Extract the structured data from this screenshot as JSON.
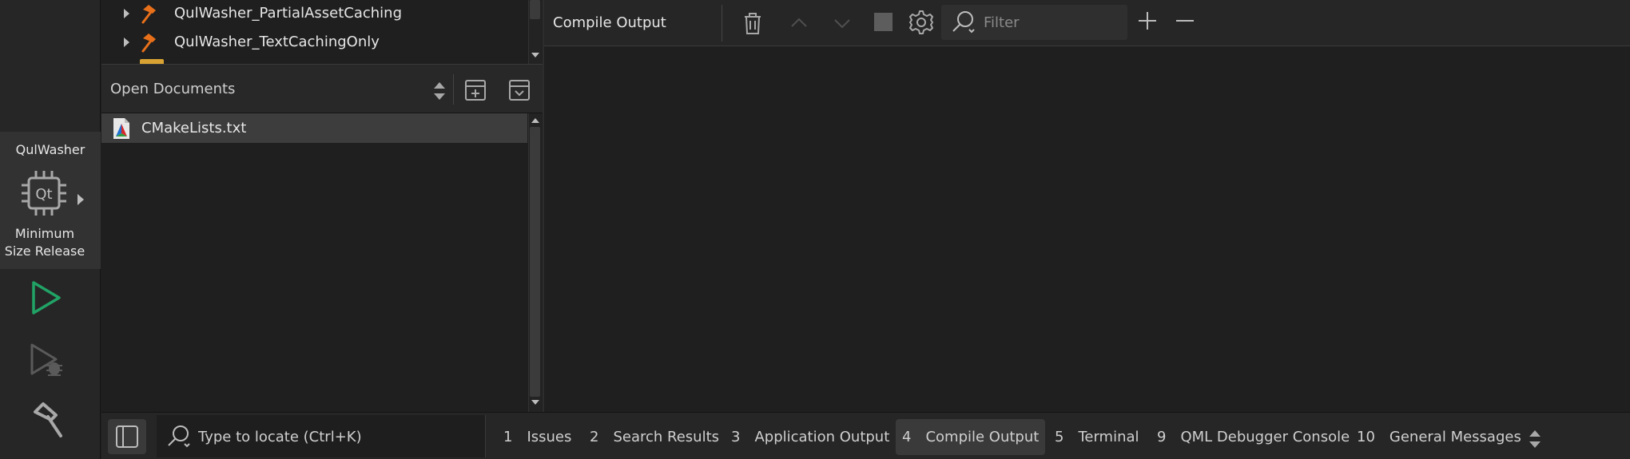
{
  "kit": {
    "project": "QulWasher",
    "build_config": "Minimum Size Release",
    "icon": "qt-chip-icon"
  },
  "modebar": {
    "run_icon": "run-icon",
    "debug_icon": "debug-run-icon",
    "build_icon": "hammer-icon",
    "run_color": "#21a366"
  },
  "project_tree": {
    "items": [
      {
        "label": "QulWasher_PartialAssetCaching",
        "icon": "hammer-icon"
      },
      {
        "label": "QulWasher_TextCachingOnly",
        "icon": "hammer-icon"
      }
    ]
  },
  "open_documents": {
    "title": "Open Documents",
    "documents": [
      {
        "label": "CMakeLists.txt",
        "icon": "cmake-file-icon"
      }
    ]
  },
  "output_pane": {
    "title": "Compile Output",
    "filter_placeholder": "Filter"
  },
  "statusbar": {
    "locator_placeholder": "Type to locate (Ctrl+K)",
    "tabs": [
      {
        "num": "1",
        "label": "Issues",
        "active": false
      },
      {
        "num": "2",
        "label": "Search Results",
        "active": false
      },
      {
        "num": "3",
        "label": "Application Output",
        "active": false
      },
      {
        "num": "4",
        "label": "Compile Output",
        "active": true
      },
      {
        "num": "5",
        "label": "Terminal",
        "active": false
      },
      {
        "num": "9",
        "label": "QML Debugger Console",
        "active": false
      },
      {
        "num": "10",
        "label": "General Messages",
        "active": false
      }
    ]
  },
  "colors": {
    "background": "#1f1f1f",
    "panel": "#262626",
    "selection": "#3d3d3d",
    "hammer_accent": "#e8701a",
    "folder": "#d9a334"
  }
}
